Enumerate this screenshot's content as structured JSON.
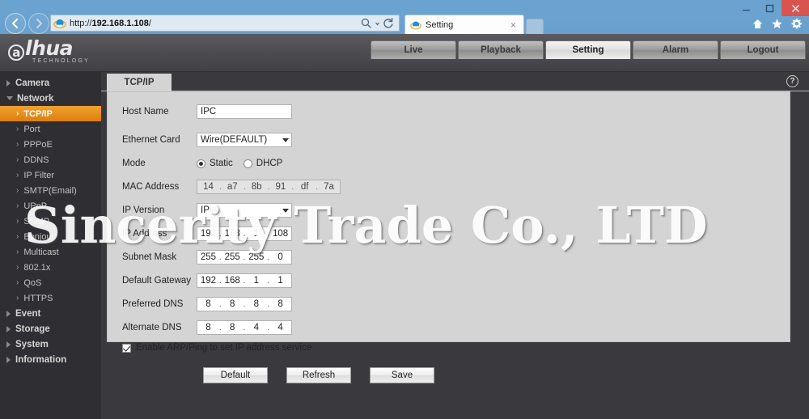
{
  "browser": {
    "url_scheme": "http://",
    "url_host": "192.168.1.108",
    "url_path": "/",
    "back_icon": "back-arrow-icon",
    "forward_icon": "forward-arrow-icon",
    "search_icon": "search-icon",
    "refresh_icon": "refresh-icon",
    "tab_title": "Setting",
    "tab_close": "×",
    "home_icon": "home-icon",
    "favorites_icon": "star-icon",
    "tools_icon": "gear-icon",
    "minimize": "minimize-icon",
    "maximize": "maximize-icon",
    "close": "close-icon"
  },
  "app": {
    "logo_at": "a",
    "logo_text": "lhua",
    "logo_sub": "TECHNOLOGY",
    "top_tabs": [
      {
        "label": "Live",
        "active": false
      },
      {
        "label": "Playback",
        "active": false
      },
      {
        "label": "Setting",
        "active": true
      },
      {
        "label": "Alarm",
        "active": false
      },
      {
        "label": "Logout",
        "active": false
      }
    ]
  },
  "sidebar": {
    "groups": [
      {
        "label": "Camera",
        "expanded": false,
        "items": []
      },
      {
        "label": "Network",
        "expanded": true,
        "items": [
          {
            "label": "TCP/IP",
            "active": true
          },
          {
            "label": "Port",
            "active": false
          },
          {
            "label": "PPPoE",
            "active": false
          },
          {
            "label": "DDNS",
            "active": false
          },
          {
            "label": "IP Filter",
            "active": false
          },
          {
            "label": "SMTP(Email)",
            "active": false
          },
          {
            "label": "UPnP",
            "active": false
          },
          {
            "label": "SNMP",
            "active": false
          },
          {
            "label": "Bonjour",
            "active": false
          },
          {
            "label": "Multicast",
            "active": false
          },
          {
            "label": "802.1x",
            "active": false
          },
          {
            "label": "QoS",
            "active": false
          },
          {
            "label": "HTTPS",
            "active": false
          }
        ]
      },
      {
        "label": "Event",
        "expanded": false,
        "items": []
      },
      {
        "label": "Storage",
        "expanded": false,
        "items": []
      },
      {
        "label": "System",
        "expanded": false,
        "items": []
      },
      {
        "label": "Information",
        "expanded": false,
        "items": []
      }
    ]
  },
  "panel": {
    "tab_label": "TCP/IP",
    "help_label": "?",
    "fields": {
      "host_name_label": "Host Name",
      "host_name_value": "IPC",
      "ethernet_card_label": "Ethernet Card",
      "ethernet_card_value": "Wire(DEFAULT)",
      "mode_label": "Mode",
      "mode_static_label": "Static",
      "mode_dhcp_label": "DHCP",
      "mode_selected": "Static",
      "mac_label": "MAC Address",
      "mac_octets": [
        "14",
        "a7",
        "8b",
        "91",
        "df",
        "7a"
      ],
      "ip_version_label": "IP Version",
      "ip_version_value": "IPv4",
      "ip_address_label": "IP Address",
      "ip_address_octets": [
        "192",
        "168",
        "1",
        "108"
      ],
      "subnet_label": "Subnet Mask",
      "subnet_octets": [
        "255",
        "255",
        "255",
        "0"
      ],
      "gateway_label": "Default Gateway",
      "gateway_octets": [
        "192",
        "168",
        "1",
        "1"
      ],
      "preferred_dns_label": "Preferred DNS",
      "preferred_dns_octets": [
        "8",
        "8",
        "8",
        "8"
      ],
      "alternate_dns_label": "Alternate DNS",
      "alternate_dns_octets": [
        "8",
        "8",
        "4",
        "4"
      ],
      "arp_ping_label": "Enable ARP/Ping to set IP address service",
      "arp_ping_checked": true
    },
    "buttons": [
      {
        "label": "Default"
      },
      {
        "label": "Refresh"
      },
      {
        "label": "Save"
      }
    ]
  },
  "watermark": {
    "text": "Sincerity Trade Co., LTD"
  },
  "colors": {
    "accent": "#e8901f",
    "sidebar_bg": "#2f2f33",
    "panel_bg": "#d4d4d4",
    "chrome_blue": "#6ba3d0",
    "close_red": "#d9534f"
  }
}
